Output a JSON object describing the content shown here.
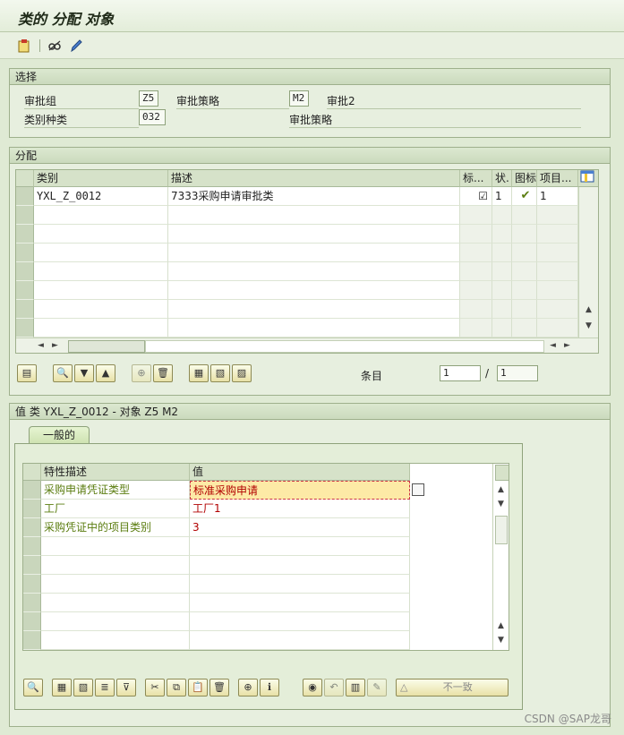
{
  "window": {
    "title": "类的 分配 对象"
  },
  "selection": {
    "title": "选择",
    "approval_group_label": "审批组",
    "approval_group_value": "Z5",
    "approval_strategy_label": "审批策略",
    "approval_strategy_value": "M2",
    "approval_strategy_text": "审批2",
    "class_type_label": "类别种类",
    "class_type_value": "032",
    "approval_strategy_text2": "审批策略"
  },
  "assignment": {
    "title": "分配",
    "columns": [
      "类别",
      "描述",
      "标...",
      "状.",
      "图标",
      "项目..."
    ],
    "rows": [
      {
        "class": "YXL_Z_0012",
        "desc": "7333采购申请审批类",
        "std": "☑",
        "status": "1",
        "icon": "✔",
        "item": "1"
      }
    ],
    "entry_label": "条目",
    "entry_value": "1",
    "entry_sep": "/",
    "entry_total": "1"
  },
  "values": {
    "title": "值 类 YXL_Z_0012 - 对象 Z5 M2",
    "tab_general": "一般的",
    "columns": [
      "特性描述",
      "值"
    ],
    "rows": [
      {
        "char": "采购申请凭证类型",
        "val": "标准采购申请"
      },
      {
        "char": "工厂",
        "val": "工厂1"
      },
      {
        "char": "采购凭证中的项目类别",
        "val": "3"
      }
    ],
    "inconsistent_button": "不一致"
  },
  "watermark": "CSDN @SAP龙哥",
  "colors": {
    "accent_green": "#5b7d10",
    "value_red": "#b10000",
    "background": "#dfead4"
  }
}
